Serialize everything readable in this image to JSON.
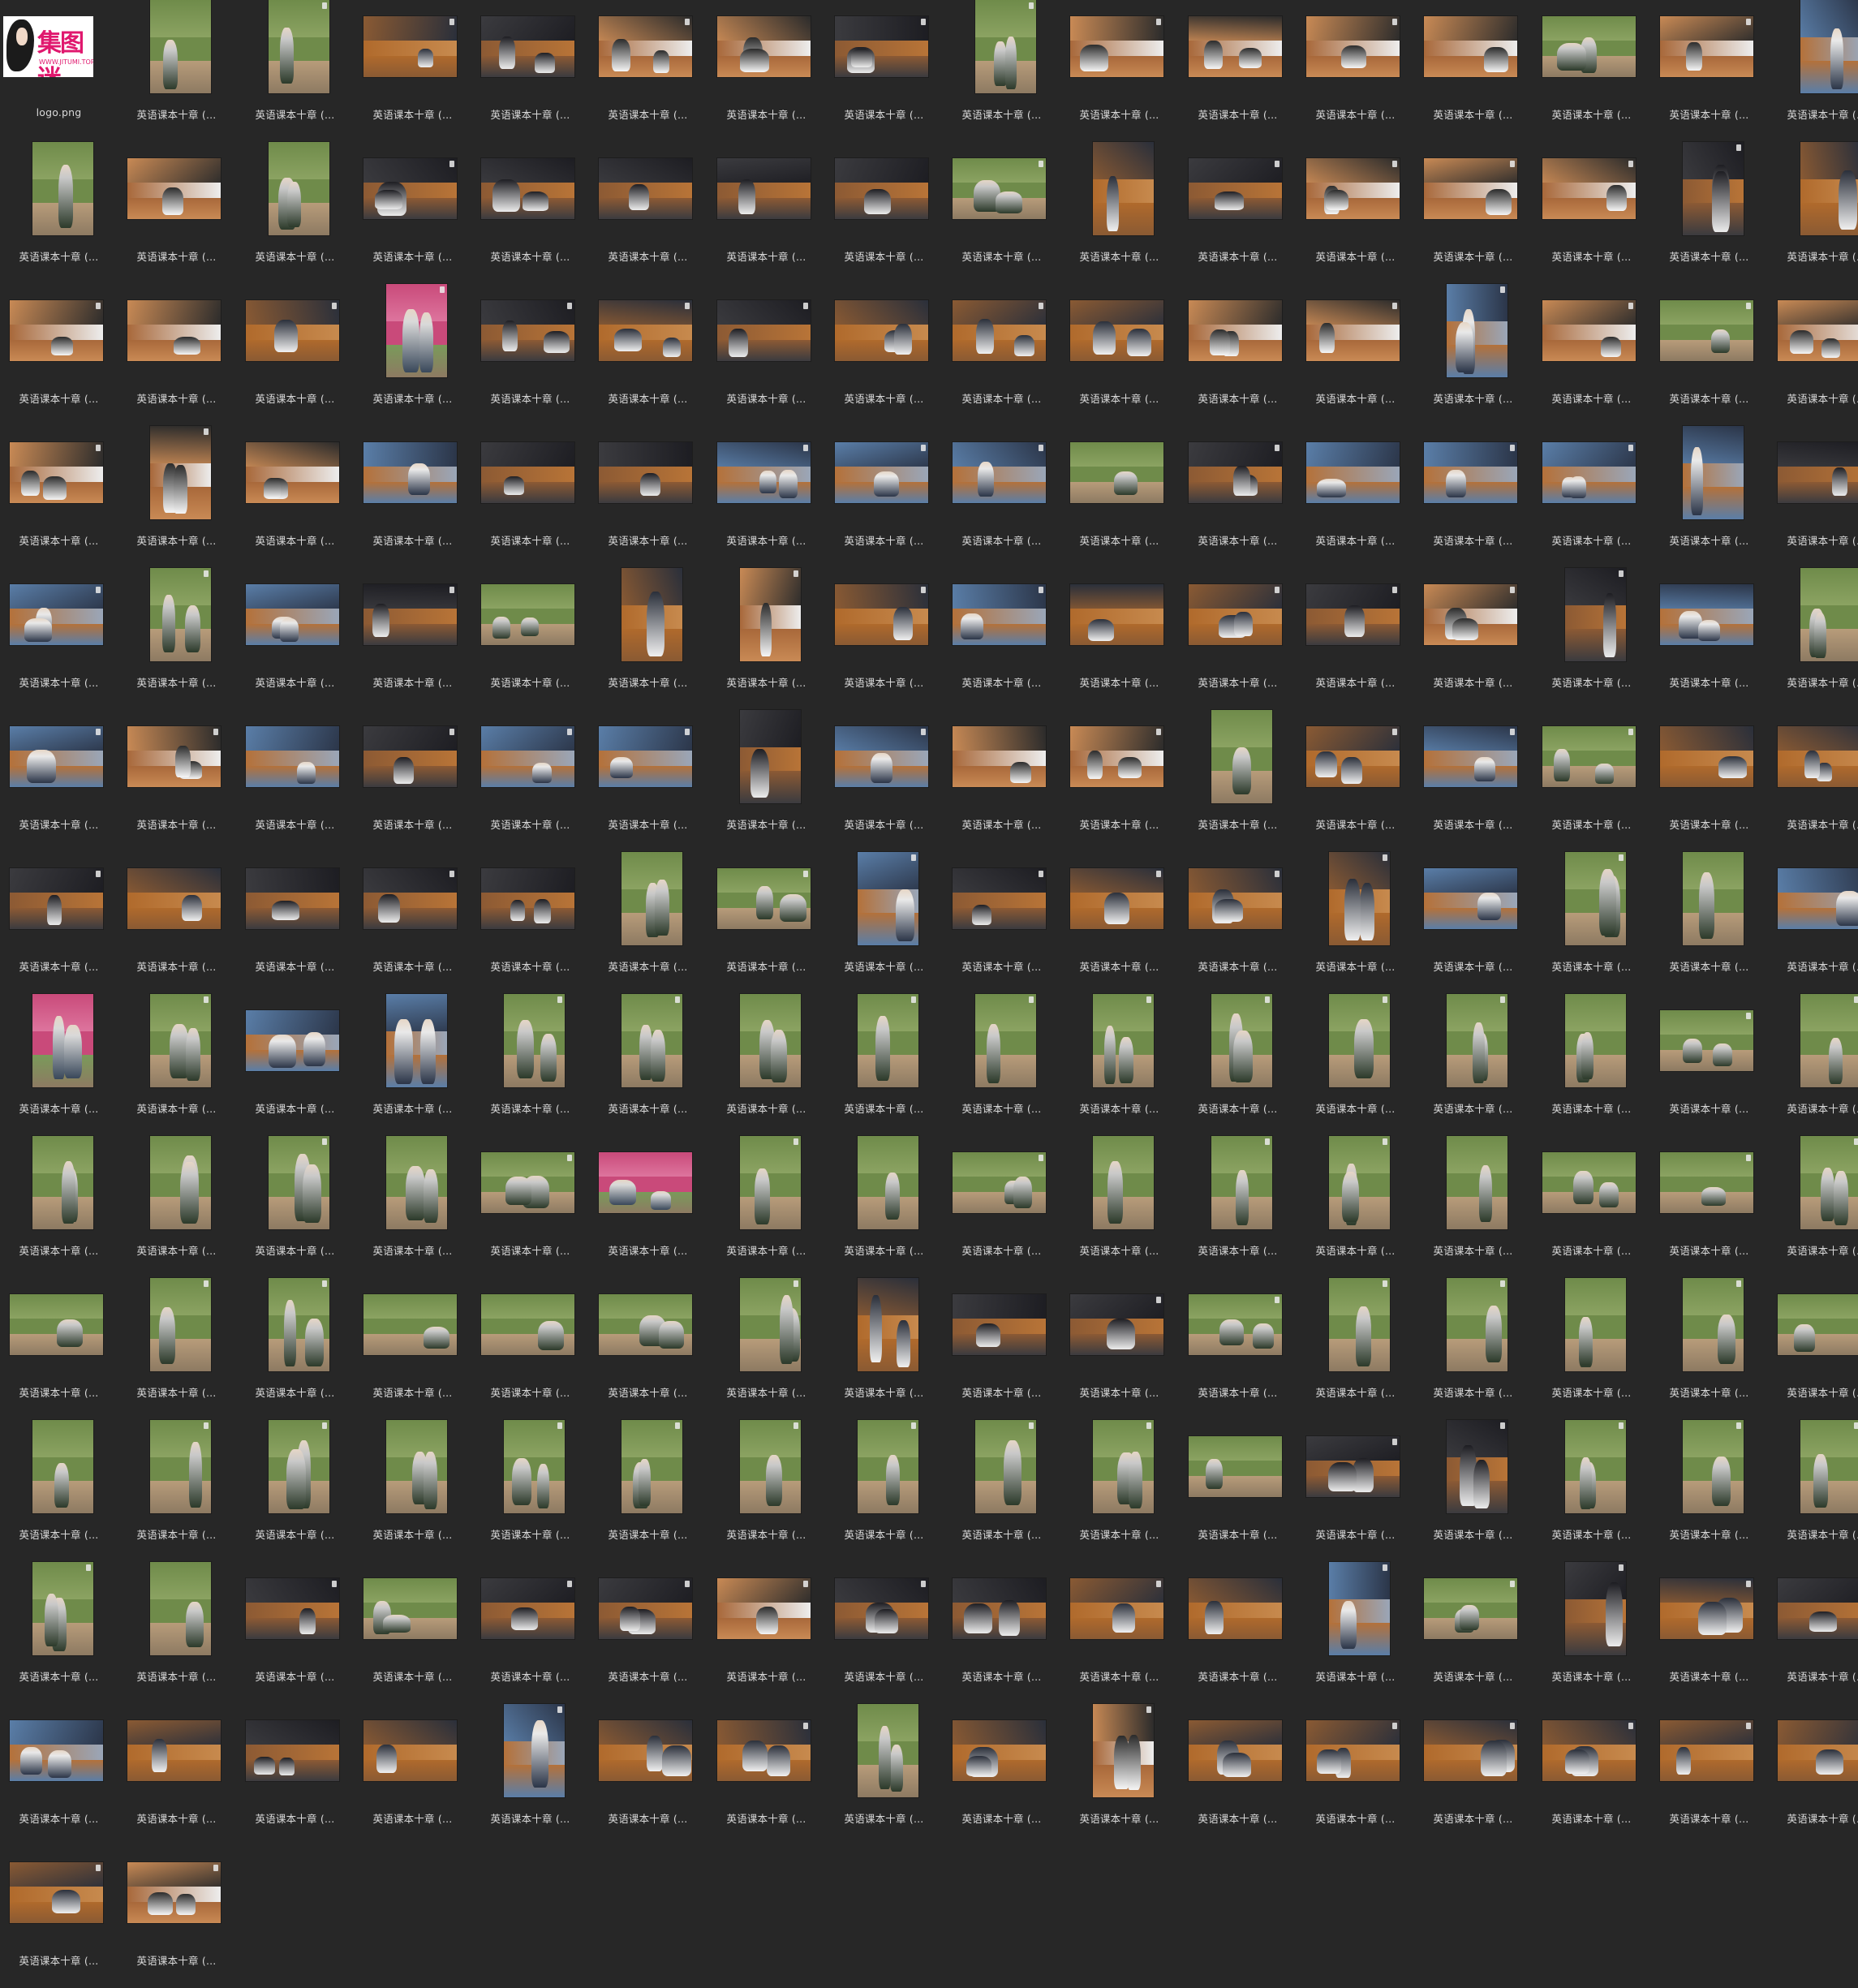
{
  "window": {
    "view": "thumbnail-grid",
    "background": "#272727",
    "label_color": "#d9d9d9"
  },
  "logo_item": {
    "filename": "logo.png",
    "logo_text": "集图迷",
    "logo_url": "WWW.JITUMI.TOP"
  },
  "file_label": "英语课本十章 (...",
  "files": [
    {
      "kind": "logo"
    },
    {
      "o": "p",
      "s": "park"
    },
    {
      "o": "p",
      "s": "park"
    },
    {
      "o": "l",
      "s": "bench"
    },
    {
      "o": "l",
      "s": "dark"
    },
    {
      "o": "l",
      "s": "socks"
    },
    {
      "o": "l",
      "s": "socks"
    },
    {
      "o": "l",
      "s": "dark"
    },
    {
      "o": "p",
      "s": "park"
    },
    {
      "o": "l",
      "s": "socks"
    },
    {
      "o": "l",
      "s": "socks"
    },
    {
      "o": "l",
      "s": "socks"
    },
    {
      "o": "l",
      "s": "socks"
    },
    {
      "o": "l",
      "s": "park"
    },
    {
      "o": "l",
      "s": "socks"
    },
    {
      "o": "p",
      "s": "blue"
    },
    {
      "o": "p",
      "s": "park"
    },
    {
      "o": "l",
      "s": "socks"
    },
    {
      "o": "p",
      "s": "park"
    },
    {
      "o": "l",
      "s": "dark"
    },
    {
      "o": "l",
      "s": "dark"
    },
    {
      "o": "l",
      "s": "dark"
    },
    {
      "o": "l",
      "s": "dark"
    },
    {
      "o": "l",
      "s": "dark"
    },
    {
      "o": "l",
      "s": "park"
    },
    {
      "o": "p",
      "s": "bench"
    },
    {
      "o": "l",
      "s": "dark"
    },
    {
      "o": "l",
      "s": "socks"
    },
    {
      "o": "l",
      "s": "socks"
    },
    {
      "o": "l",
      "s": "socks"
    },
    {
      "o": "p",
      "s": "dark"
    },
    {
      "o": "p",
      "s": "bench"
    },
    {
      "o": "l",
      "s": "socks"
    },
    {
      "o": "l",
      "s": "socks"
    },
    {
      "o": "l",
      "s": "bench"
    },
    {
      "o": "p",
      "s": "pink"
    },
    {
      "o": "l",
      "s": "dark"
    },
    {
      "o": "l",
      "s": "bench"
    },
    {
      "o": "l",
      "s": "dark"
    },
    {
      "o": "l",
      "s": "bench"
    },
    {
      "o": "l",
      "s": "bench"
    },
    {
      "o": "l",
      "s": "bench"
    },
    {
      "o": "l",
      "s": "socks"
    },
    {
      "o": "l",
      "s": "socks"
    },
    {
      "o": "p",
      "s": "blue"
    },
    {
      "o": "l",
      "s": "socks"
    },
    {
      "o": "l",
      "s": "park"
    },
    {
      "o": "l",
      "s": "socks"
    },
    {
      "o": "l",
      "s": "socks"
    },
    {
      "o": "p",
      "s": "socks"
    },
    {
      "o": "l",
      "s": "socks"
    },
    {
      "o": "l",
      "s": "blue"
    },
    {
      "o": "l",
      "s": "dark"
    },
    {
      "o": "l",
      "s": "dark"
    },
    {
      "o": "l",
      "s": "blue"
    },
    {
      "o": "l",
      "s": "blue"
    },
    {
      "o": "l",
      "s": "blue"
    },
    {
      "o": "l",
      "s": "park"
    },
    {
      "o": "l",
      "s": "dark"
    },
    {
      "o": "l",
      "s": "blue"
    },
    {
      "o": "l",
      "s": "blue"
    },
    {
      "o": "l",
      "s": "blue"
    },
    {
      "o": "p",
      "s": "blue"
    },
    {
      "o": "l",
      "s": "dark"
    },
    {
      "o": "l",
      "s": "blue"
    },
    {
      "o": "p",
      "s": "park"
    },
    {
      "o": "l",
      "s": "blue"
    },
    {
      "o": "l",
      "s": "dark"
    },
    {
      "o": "l",
      "s": "park"
    },
    {
      "o": "p",
      "s": "bench"
    },
    {
      "o": "p",
      "s": "socks"
    },
    {
      "o": "l",
      "s": "bench"
    },
    {
      "o": "l",
      "s": "blue"
    },
    {
      "o": "l",
      "s": "bench"
    },
    {
      "o": "l",
      "s": "bench"
    },
    {
      "o": "l",
      "s": "dark"
    },
    {
      "o": "l",
      "s": "socks"
    },
    {
      "o": "p",
      "s": "dark"
    },
    {
      "o": "l",
      "s": "blue"
    },
    {
      "o": "p",
      "s": "park"
    },
    {
      "o": "l",
      "s": "blue"
    },
    {
      "o": "l",
      "s": "socks"
    },
    {
      "o": "l",
      "s": "blue"
    },
    {
      "o": "l",
      "s": "dark"
    },
    {
      "o": "l",
      "s": "blue"
    },
    {
      "o": "l",
      "s": "blue"
    },
    {
      "o": "p",
      "s": "dark"
    },
    {
      "o": "l",
      "s": "blue"
    },
    {
      "o": "l",
      "s": "socks"
    },
    {
      "o": "l",
      "s": "socks"
    },
    {
      "o": "p",
      "s": "park"
    },
    {
      "o": "l",
      "s": "bench"
    },
    {
      "o": "l",
      "s": "blue"
    },
    {
      "o": "l",
      "s": "park"
    },
    {
      "o": "l",
      "s": "bench"
    },
    {
      "o": "l",
      "s": "bench"
    },
    {
      "o": "l",
      "s": "dark"
    },
    {
      "o": "l",
      "s": "bench"
    },
    {
      "o": "l",
      "s": "dark"
    },
    {
      "o": "l",
      "s": "dark"
    },
    {
      "o": "l",
      "s": "dark"
    },
    {
      "o": "p",
      "s": "park"
    },
    {
      "o": "l",
      "s": "park"
    },
    {
      "o": "p",
      "s": "blue"
    },
    {
      "o": "l",
      "s": "dark"
    },
    {
      "o": "l",
      "s": "bench"
    },
    {
      "o": "l",
      "s": "bench"
    },
    {
      "o": "p",
      "s": "bench"
    },
    {
      "o": "l",
      "s": "blue"
    },
    {
      "o": "p",
      "s": "park"
    },
    {
      "o": "p",
      "s": "park"
    },
    {
      "o": "l",
      "s": "blue"
    },
    {
      "o": "p",
      "s": "pink"
    },
    {
      "o": "p",
      "s": "park"
    },
    {
      "o": "l",
      "s": "blue"
    },
    {
      "o": "p",
      "s": "blue"
    },
    {
      "o": "p",
      "s": "park"
    },
    {
      "o": "p",
      "s": "park"
    },
    {
      "o": "p",
      "s": "park"
    },
    {
      "o": "p",
      "s": "park"
    },
    {
      "o": "p",
      "s": "park"
    },
    {
      "o": "p",
      "s": "park"
    },
    {
      "o": "p",
      "s": "park"
    },
    {
      "o": "p",
      "s": "park"
    },
    {
      "o": "p",
      "s": "park"
    },
    {
      "o": "p",
      "s": "park"
    },
    {
      "o": "l",
      "s": "park"
    },
    {
      "o": "p",
      "s": "park"
    },
    {
      "o": "p",
      "s": "park"
    },
    {
      "o": "p",
      "s": "park"
    },
    {
      "o": "p",
      "s": "park"
    },
    {
      "o": "p",
      "s": "park"
    },
    {
      "o": "l",
      "s": "park"
    },
    {
      "o": "l",
      "s": "pink"
    },
    {
      "o": "p",
      "s": "park"
    },
    {
      "o": "p",
      "s": "park"
    },
    {
      "o": "l",
      "s": "park"
    },
    {
      "o": "p",
      "s": "park"
    },
    {
      "o": "p",
      "s": "park"
    },
    {
      "o": "p",
      "s": "park"
    },
    {
      "o": "p",
      "s": "park"
    },
    {
      "o": "l",
      "s": "park"
    },
    {
      "o": "l",
      "s": "park"
    },
    {
      "o": "p",
      "s": "park"
    },
    {
      "o": "l",
      "s": "park"
    },
    {
      "o": "p",
      "s": "park"
    },
    {
      "o": "p",
      "s": "park"
    },
    {
      "o": "l",
      "s": "park"
    },
    {
      "o": "l",
      "s": "park"
    },
    {
      "o": "l",
      "s": "park"
    },
    {
      "o": "p",
      "s": "park"
    },
    {
      "o": "p",
      "s": "bench"
    },
    {
      "o": "l",
      "s": "dark"
    },
    {
      "o": "l",
      "s": "dark"
    },
    {
      "o": "l",
      "s": "park"
    },
    {
      "o": "p",
      "s": "park"
    },
    {
      "o": "p",
      "s": "park"
    },
    {
      "o": "p",
      "s": "park"
    },
    {
      "o": "p",
      "s": "park"
    },
    {
      "o": "l",
      "s": "park"
    },
    {
      "o": "p",
      "s": "park"
    },
    {
      "o": "p",
      "s": "park"
    },
    {
      "o": "p",
      "s": "park"
    },
    {
      "o": "p",
      "s": "park"
    },
    {
      "o": "p",
      "s": "park"
    },
    {
      "o": "p",
      "s": "park"
    },
    {
      "o": "p",
      "s": "park"
    },
    {
      "o": "p",
      "s": "park"
    },
    {
      "o": "p",
      "s": "park"
    },
    {
      "o": "p",
      "s": "park"
    },
    {
      "o": "l",
      "s": "park"
    },
    {
      "o": "l",
      "s": "dark"
    },
    {
      "o": "p",
      "s": "dark"
    },
    {
      "o": "p",
      "s": "park"
    },
    {
      "o": "p",
      "s": "park"
    },
    {
      "o": "p",
      "s": "park"
    },
    {
      "o": "p",
      "s": "park"
    },
    {
      "o": "p",
      "s": "park"
    },
    {
      "o": "l",
      "s": "dark"
    },
    {
      "o": "l",
      "s": "park"
    },
    {
      "o": "l",
      "s": "dark"
    },
    {
      "o": "l",
      "s": "dark"
    },
    {
      "o": "l",
      "s": "socks"
    },
    {
      "o": "l",
      "s": "dark"
    },
    {
      "o": "l",
      "s": "dark"
    },
    {
      "o": "l",
      "s": "bench"
    },
    {
      "o": "l",
      "s": "bench"
    },
    {
      "o": "p",
      "s": "blue"
    },
    {
      "o": "l",
      "s": "park"
    },
    {
      "o": "p",
      "s": "dark"
    },
    {
      "o": "l",
      "s": "bench"
    },
    {
      "o": "l",
      "s": "dark"
    },
    {
      "o": "l",
      "s": "blue"
    },
    {
      "o": "l",
      "s": "bench"
    },
    {
      "o": "l",
      "s": "dark"
    },
    {
      "o": "l",
      "s": "bench"
    },
    {
      "o": "p",
      "s": "blue"
    },
    {
      "o": "l",
      "s": "bench"
    },
    {
      "o": "l",
      "s": "bench"
    },
    {
      "o": "p",
      "s": "park"
    },
    {
      "o": "l",
      "s": "bench"
    },
    {
      "o": "p",
      "s": "socks"
    },
    {
      "o": "l",
      "s": "bench"
    },
    {
      "o": "l",
      "s": "bench"
    },
    {
      "o": "l",
      "s": "bench"
    },
    {
      "o": "l",
      "s": "bench"
    },
    {
      "o": "l",
      "s": "bench"
    },
    {
      "o": "l",
      "s": "bench"
    },
    {
      "o": "l",
      "s": "bench"
    },
    {
      "o": "l",
      "s": "socks"
    }
  ]
}
